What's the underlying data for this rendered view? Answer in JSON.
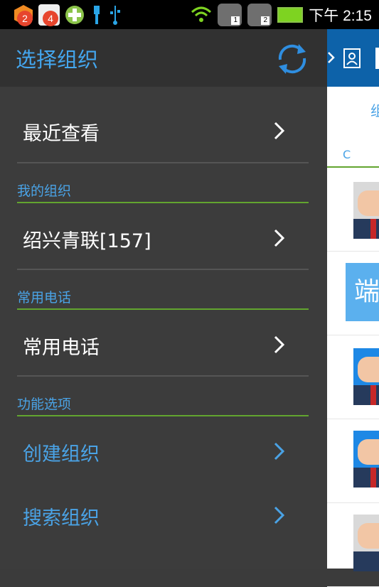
{
  "status_bar": {
    "notifications": [
      {
        "badge": "2",
        "color": "#f08a22"
      },
      {
        "badge": "4",
        "color": "#e74c3c"
      }
    ],
    "sim_labels": [
      "1",
      "2"
    ],
    "time": "下午 2:15"
  },
  "drawer": {
    "title": "选择组织",
    "recent": "最近查看",
    "sections": [
      {
        "title": "我的组织",
        "item": "绍兴青联[157]"
      },
      {
        "title": "常用电话",
        "item": "常用电话"
      },
      {
        "title": "功能选项",
        "items": [
          "创建组织",
          "搜索组织"
        ]
      }
    ]
  },
  "content": {
    "tab_fragment": "组",
    "index_letter": "C",
    "name_tile_char": "端"
  },
  "colors": {
    "accent_blue": "#4aa3e6",
    "section_line_green": "#62a52f",
    "drawer_bg": "#3c3c3c",
    "toolbar_blue": "#0d62a9"
  }
}
